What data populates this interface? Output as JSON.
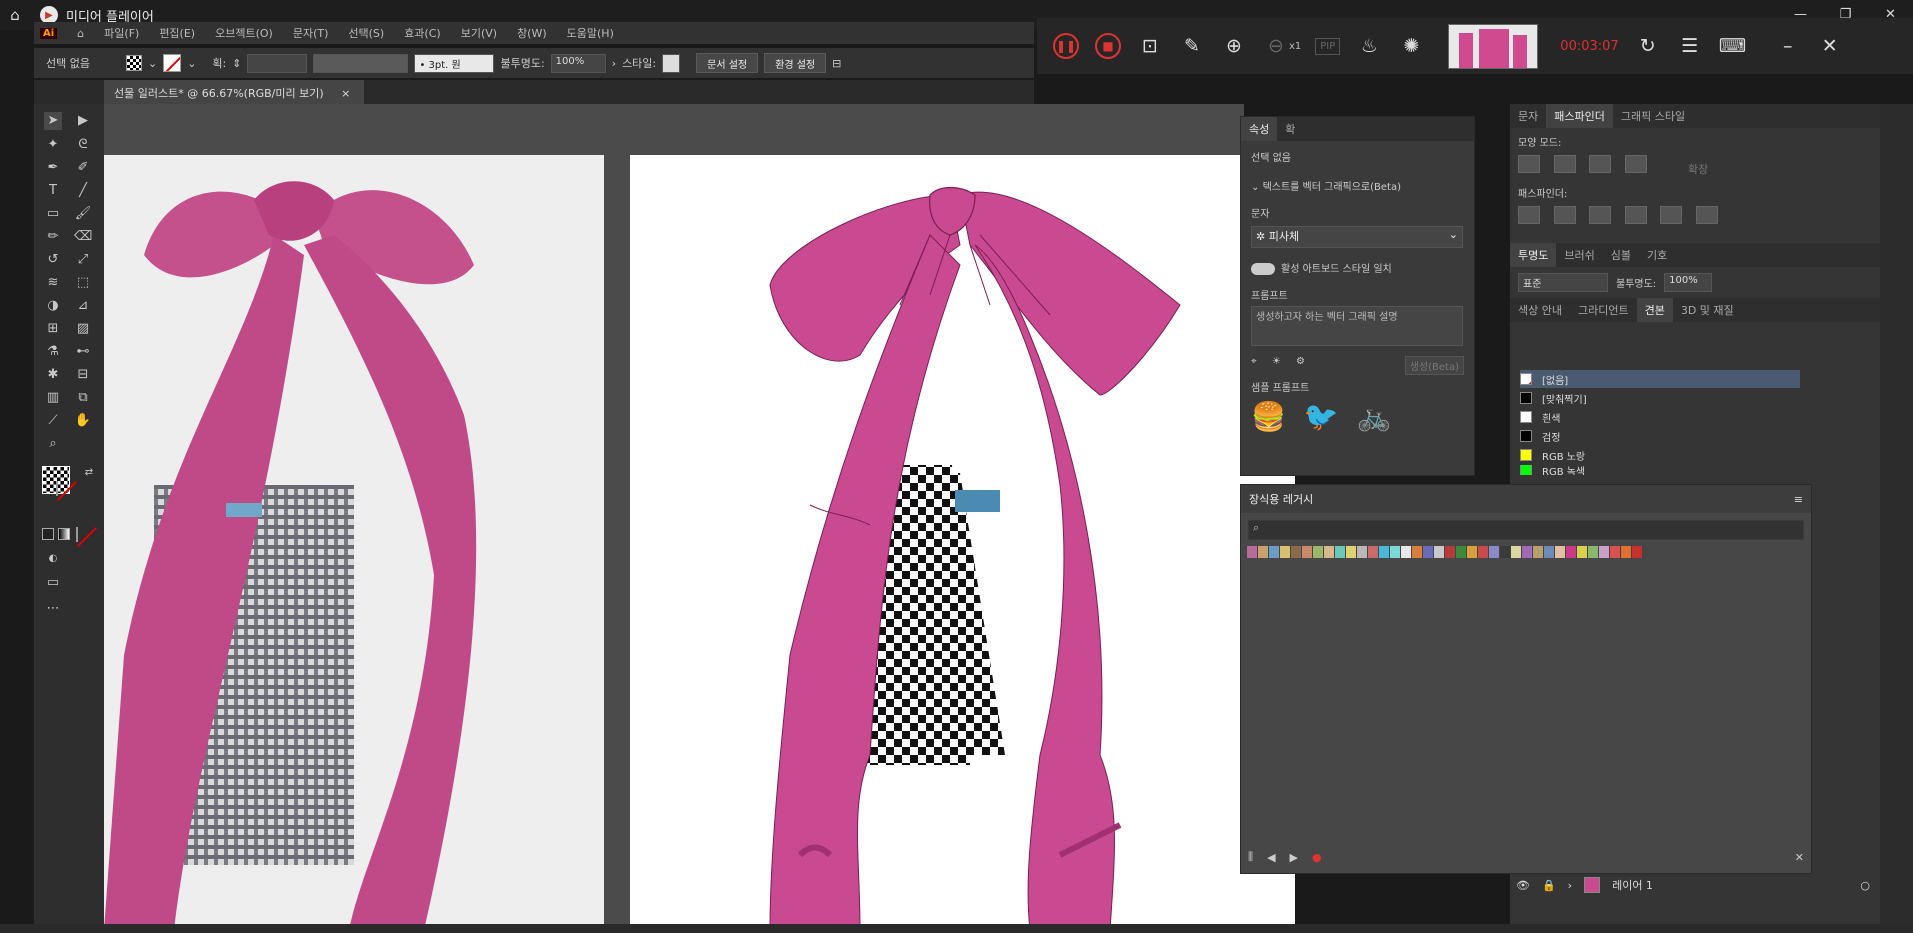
{
  "player": {
    "title": "미디어 플레이어",
    "minimize": "—",
    "restore": "❐",
    "close": "✕"
  },
  "menu": {
    "logo": "Ai",
    "items": [
      "파일(F)",
      "편집(E)",
      "오브젝트(O)",
      "문자(T)",
      "선택(S)",
      "효과(C)",
      "보기(V)",
      "창(W)",
      "도움말(H)"
    ]
  },
  "control": {
    "selection": "선택 없음",
    "stroke_label": "획:",
    "brush": "3pt. 원",
    "opacity_label": "불투명도:",
    "opacity": "100%",
    "style_label": "스타일:",
    "doc_setup": "문서 설정",
    "preferences": "환경 설정"
  },
  "recorder": {
    "time": "00:03:07",
    "zoom_suffix": "x1",
    "pip": "PIP"
  },
  "document": {
    "tab_title": "선물 일러스트* @ 66.67%(RGB/미리 보기)",
    "tab_close": "×"
  },
  "properties": {
    "tab_props": "속성",
    "tab_other": "확",
    "selection": "선택 없음",
    "text_to_vector": "텍스트를 벡터 그래픽으로(Beta)",
    "subject_label": "문자",
    "subject_value": "피사체",
    "artboard_match": "활성 아트보드 스타일 일치",
    "prompt_label": "프롬프트",
    "prompt_placeholder": "생성하고자 하는 벡터 그래픽 설명",
    "generate": "생성(Beta)",
    "sample_label": "샘플 프롬프트"
  },
  "swatch_library": {
    "title": "장식용 레거시"
  },
  "right": {
    "tabs_top": [
      "문자",
      "패스파인더",
      "그래픽 스타일"
    ],
    "shape_modes": "모양 모드:",
    "expand": "확장",
    "pathfinder": "패스파인더:",
    "tabs_mid": [
      "투명도",
      "브러쉬",
      "심볼",
      "기호"
    ],
    "blend_mode": "표준",
    "opacity_label": "불투명도:",
    "opacity": "100%",
    "tabs_swatch": [
      "색상 안내",
      "그라디언트",
      "견본",
      "3D 및 재질"
    ],
    "swatches": [
      {
        "name": "[없음]",
        "color": "#ffffff"
      },
      {
        "name": "[맞춰찍기]",
        "color": "#000000"
      },
      {
        "name": "흰색",
        "color": "#ffffff"
      },
      {
        "name": "검정",
        "color": "#000000"
      },
      {
        "name": "RGB 노랑",
        "color": "#ffff00"
      },
      {
        "name": "RGB 녹색",
        "color": "#00ff00"
      }
    ],
    "layer_name": "레이어 1"
  }
}
